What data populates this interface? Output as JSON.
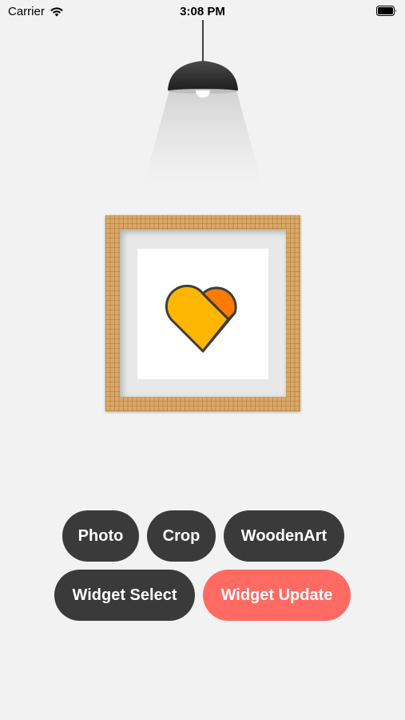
{
  "status_bar": {
    "carrier": "Carrier",
    "time": "3:08 PM",
    "icons": [
      "wifi-icon",
      "battery-icon"
    ]
  },
  "frame": {
    "style": "wooden",
    "image_icon": "heart-icon",
    "colors": {
      "heart_main": "#ffb600",
      "heart_accent": "#ff7a00",
      "outline": "#3d3d3d"
    }
  },
  "buttons": {
    "photo": "Photo",
    "crop": "Crop",
    "wooden_art": "WoodenArt",
    "widget_select": "Widget Select",
    "widget_update": "Widget Update"
  },
  "colors": {
    "background": "#f2f2f2",
    "button_dark": "#3a3a3a",
    "button_accent": "#ff6b63"
  }
}
